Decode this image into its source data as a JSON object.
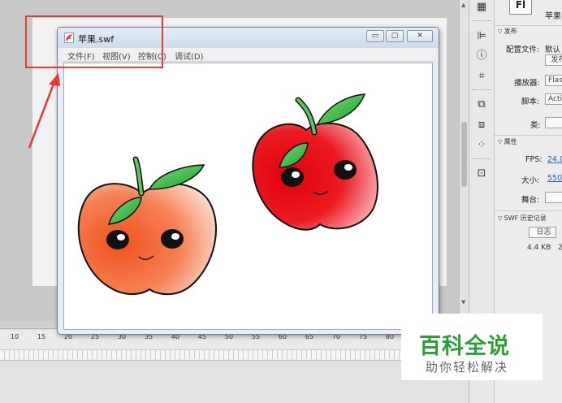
{
  "ruler": {
    "ticks": [
      "10",
      "15",
      "20",
      "25",
      "30",
      "35",
      "40",
      "45",
      "50",
      "55",
      "60",
      "65",
      "70",
      "75",
      "80"
    ]
  },
  "swf_window": {
    "title": "苹果.swf",
    "controls": {
      "minimize": "▭",
      "restore": "▢",
      "close": "✕"
    },
    "menu": [
      {
        "label": "文件(F)"
      },
      {
        "label": "视图(V)"
      },
      {
        "label": "控制(C)"
      },
      {
        "label": "调试(D)"
      }
    ]
  },
  "properties": {
    "logo": "Fl",
    "doc_title": "苹果",
    "publish": {
      "header": "发布",
      "profile_label": "配置文件:",
      "profile_value": "默认",
      "publish_button": "发布",
      "player_label": "播放器:",
      "player_value": "Flash",
      "script_label": "脚本:",
      "script_value": "Acti",
      "class_label": "类:",
      "class_value": ""
    },
    "attributes": {
      "header": "属性",
      "fps_label": "FPS:",
      "fps_value": "24.0",
      "size_label": "大小:",
      "size_value": "550",
      "stage_label": "舞台:"
    },
    "history": {
      "header": "SWF 历史记录",
      "log_button": "日志",
      "file_size": "4.4 KB",
      "extra": "2"
    }
  },
  "watermark": {
    "main": "百科全说",
    "sub": "助你轻松解决"
  },
  "colors": {
    "annotation_red": "#e53935",
    "watermark_green": "#2e9e3a",
    "link_blue": "#2a62b8"
  }
}
